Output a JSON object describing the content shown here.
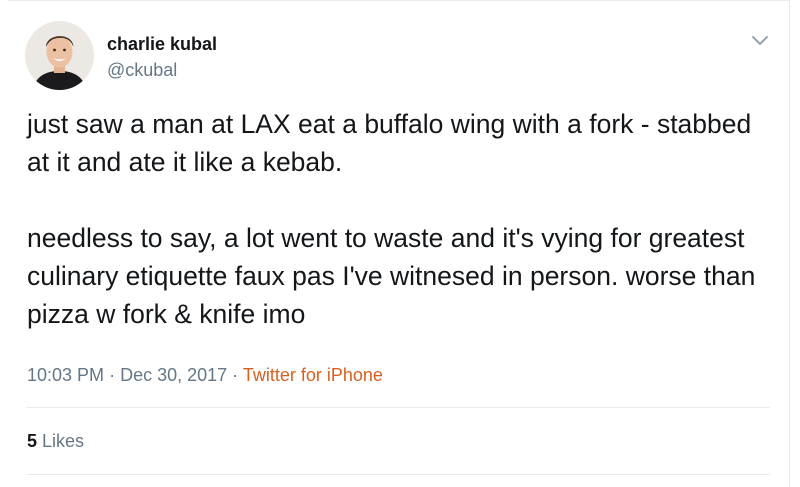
{
  "author": {
    "display_name": "charlie kubal",
    "handle": "@ckubal"
  },
  "tweet": {
    "text": "just saw a man at LAX eat a buffalo wing with a fork - stabbed at it and ate it like a kebab.\n\nneedless to say, a lot went to waste and it's vying for greatest culinary etiquette faux pas I've witnesed in person. worse than pizza w fork & knife imo",
    "time": "10:03 PM",
    "date": "Dec 30, 2017",
    "separator": "·",
    "source": "Twitter for iPhone"
  },
  "stats": {
    "likes_count": "5",
    "likes_label": "Likes"
  },
  "icons": {
    "menu": "chevron-down-icon",
    "avatar": "avatar"
  },
  "colors": {
    "text_primary": "#14171a",
    "text_secondary": "#657786",
    "source_link": "#d9601f",
    "divider": "#e6ecf0"
  }
}
